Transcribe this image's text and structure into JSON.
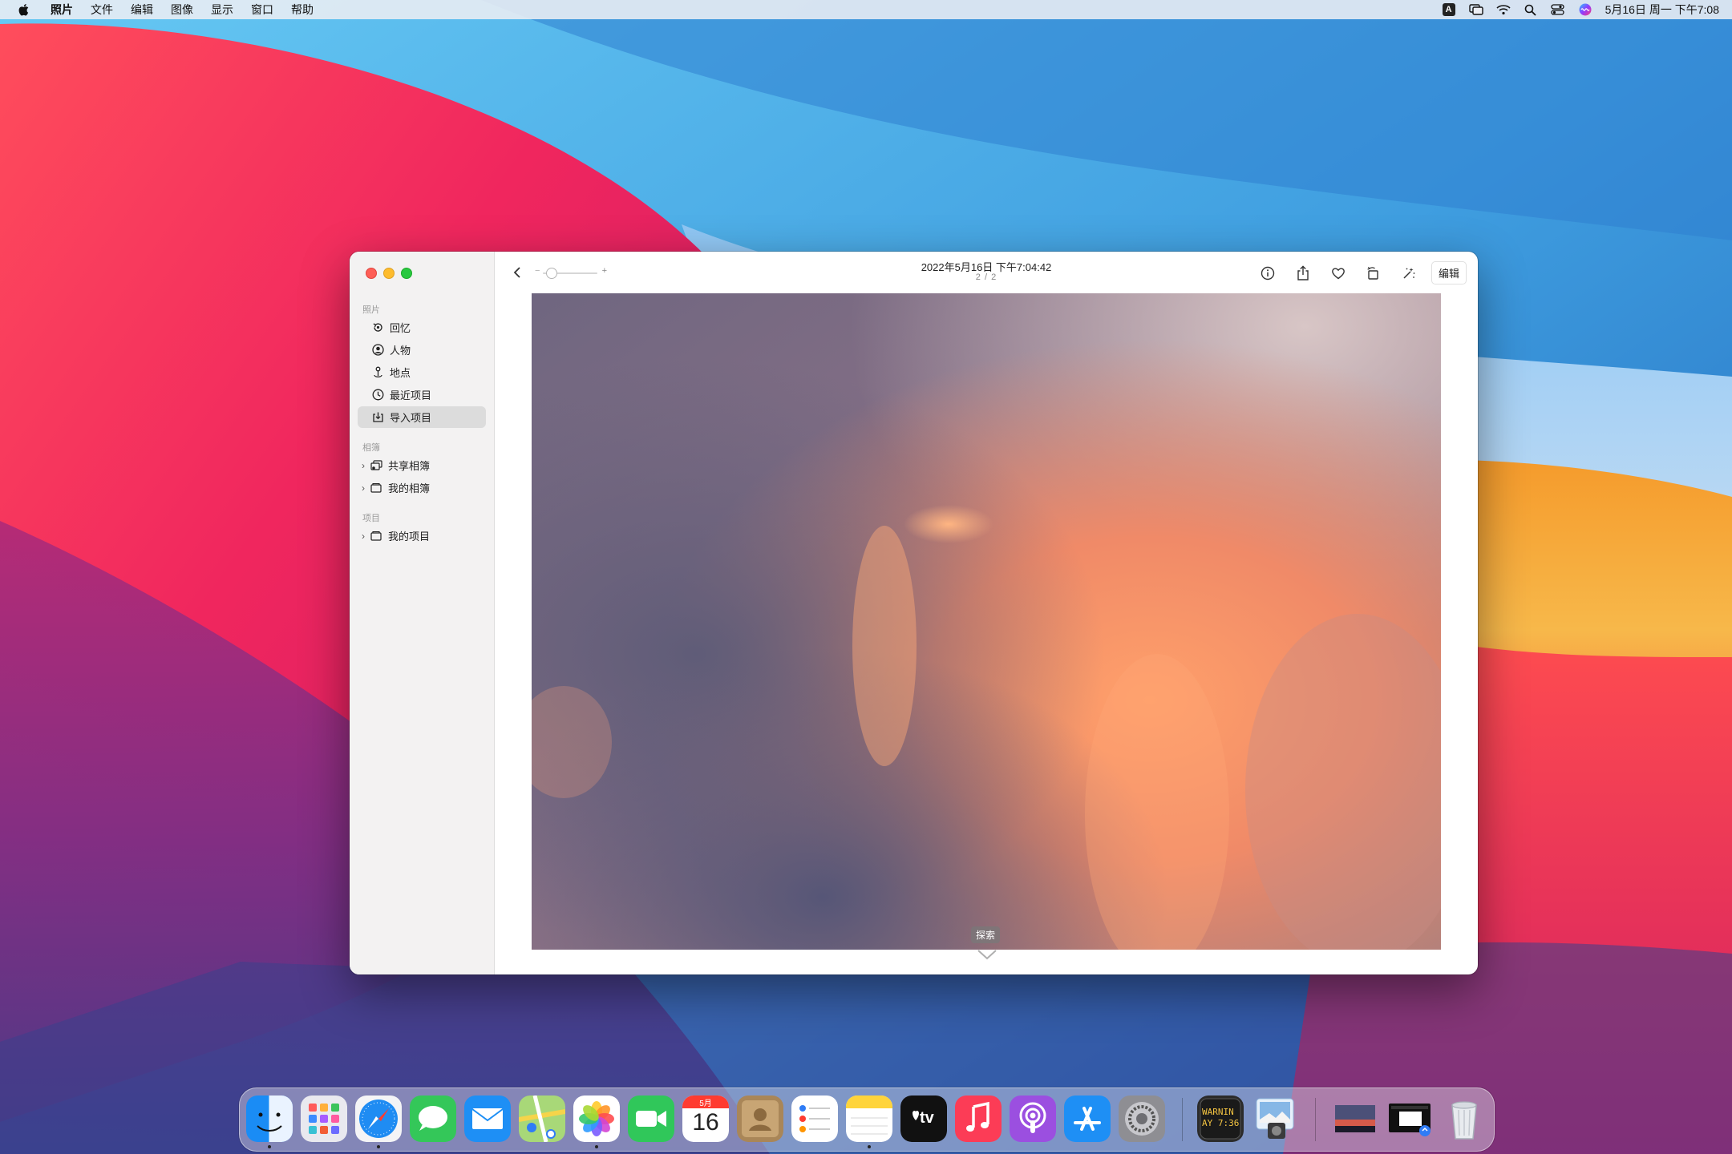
{
  "menubar": {
    "app_name": "照片",
    "menus": [
      "文件",
      "编辑",
      "图像",
      "显示",
      "窗口",
      "帮助"
    ],
    "ime_badge": "A",
    "clock": "5月16日 周一 下午7:08"
  },
  "sidebar": {
    "section_photos": "照片",
    "items_photos": [
      "回忆",
      "人物",
      "地点",
      "最近项目",
      "导入项目"
    ],
    "selected_item": "导入项目",
    "section_albums": "相簿",
    "items_albums": [
      "共享相簿",
      "我的相簿"
    ],
    "section_projects": "项目",
    "items_projects": [
      "我的项目"
    ]
  },
  "toolbar": {
    "zoom_minus": "−",
    "zoom_plus": "+",
    "title": "2022年5月16日 下午7:04:42",
    "counter": "2 / 2",
    "edit_label": "编辑"
  },
  "photo": {
    "explore_label": "探索"
  },
  "dock": {
    "calendar_month": "5月",
    "calendar_day": "16",
    "tv_label": "tv",
    "console_line1": "WARNIN",
    "console_line2": "AY 7:36",
    "apps": [
      "finder-icon",
      "launchpad-icon",
      "safari-icon",
      "messages-icon",
      "mail-icon",
      "maps-icon",
      "photos-icon",
      "facetime-icon",
      "calendar-icon",
      "contacts-icon",
      "reminders-icon",
      "notes-icon",
      "tv-icon",
      "music-icon",
      "podcasts-icon",
      "app-store-icon",
      "system-preferences-icon",
      "console-icon",
      "preview-icon",
      "recent-photo-thumbnail-icon",
      "recent-window-thumbnail-icon",
      "trash-icon"
    ],
    "running": [
      "finder-icon",
      "safari-icon",
      "photos-icon",
      "notes-icon"
    ]
  },
  "colors": {
    "accent": "#0a84ff",
    "traffic_red": "#fe5f57",
    "traffic_yellow": "#febc2e",
    "traffic_green": "#28c840",
    "sidebar_bg": "#f3f2f2"
  }
}
